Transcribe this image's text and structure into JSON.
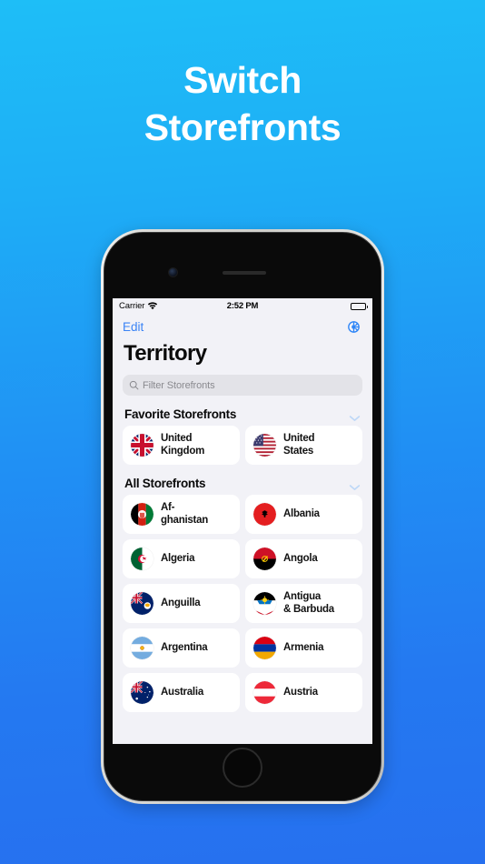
{
  "headline": {
    "line1": "Switch",
    "line2": "Storefronts"
  },
  "colors": {
    "bg_gradient_top": "#1ebef7",
    "bg_gradient_bottom": "#2670ef",
    "accent_blue": "#3b84f5",
    "screen_bg": "#f2f2f7",
    "card_bg": "#ffffff",
    "search_bg": "#e3e3e8",
    "chevron_blue": "#bdd7f7"
  },
  "status_bar": {
    "carrier": "Carrier",
    "wifi_icon": "wifi-icon",
    "time": "2:52 PM",
    "battery_icon": "battery-icon"
  },
  "nav_bar": {
    "edit_label": "Edit",
    "settings_icon": "gear-icon"
  },
  "page_title": "Territory",
  "search": {
    "icon": "search-icon",
    "placeholder": "Filter Storefronts",
    "value": ""
  },
  "sections": [
    {
      "title": "Favorite Storefronts",
      "chevron_icon": "chevron-down-icon",
      "items": [
        {
          "name": "United\nKingdom",
          "flag": "flag-gb"
        },
        {
          "name": "United\nStates",
          "flag": "flag-us"
        }
      ]
    },
    {
      "title": "All Storefronts",
      "chevron_icon": "chevron-down-icon",
      "items": [
        {
          "name": "Af-\nghanistan",
          "flag": "flag-af"
        },
        {
          "name": "Albania",
          "flag": "flag-al"
        },
        {
          "name": "Algeria",
          "flag": "flag-dz"
        },
        {
          "name": "Angola",
          "flag": "flag-ao"
        },
        {
          "name": "Anguilla",
          "flag": "flag-ai"
        },
        {
          "name": "Antigua\n& Barbuda",
          "flag": "flag-ag"
        },
        {
          "name": "Argentina",
          "flag": "flag-ar"
        },
        {
          "name": "Armenia",
          "flag": "flag-am"
        },
        {
          "name": "Australia",
          "flag": "flag-au"
        },
        {
          "name": "Austria",
          "flag": "flag-at"
        }
      ]
    }
  ]
}
